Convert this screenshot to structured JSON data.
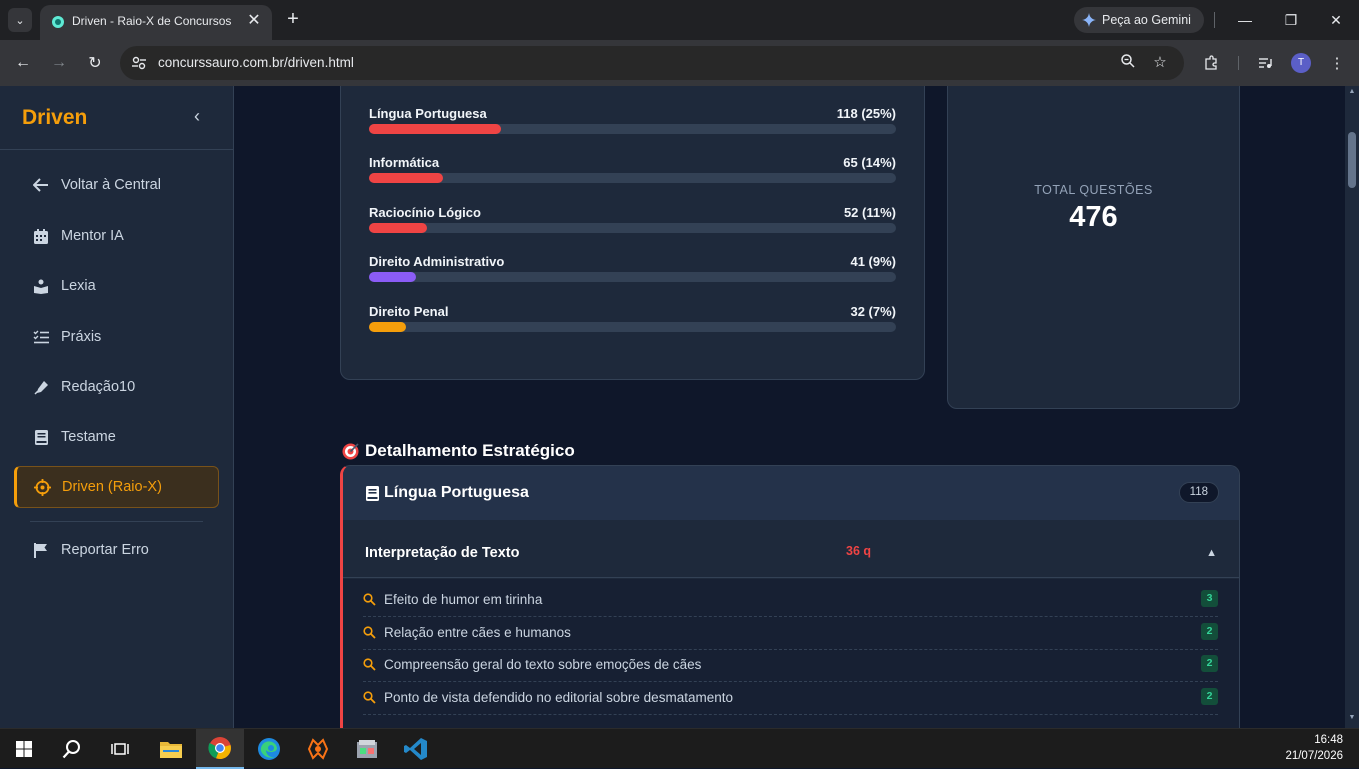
{
  "browser": {
    "tab_title": "Driven - Raio-X de Concursos",
    "url": "concurssauro.com.br/driven.html",
    "gemini_label": "Peça ao Gemini",
    "profile_initial": "T"
  },
  "sidebar": {
    "brand": "Driven",
    "items": [
      {
        "label": "Voltar à Central",
        "icon": "arrow-left-icon"
      },
      {
        "label": "Mentor IA",
        "icon": "calendar-icon"
      },
      {
        "label": "Lexia",
        "icon": "reader-icon"
      },
      {
        "label": "Práxis",
        "icon": "checklist-icon"
      },
      {
        "label": "Redação10",
        "icon": "pen-icon"
      },
      {
        "label": "Testame",
        "icon": "book-icon"
      },
      {
        "label": "Driven (Raio-X)",
        "icon": "crosshair-icon",
        "active": true
      },
      {
        "label": "Reportar Erro",
        "icon": "flag-icon"
      }
    ]
  },
  "distribution": [
    {
      "name": "Língua Portuguesa",
      "value": "118 (25%)",
      "percent": 25,
      "color": "#ef4444"
    },
    {
      "name": "Informática",
      "value": "65 (14%)",
      "percent": 14,
      "color": "#ef4444"
    },
    {
      "name": "Raciocínio Lógico",
      "value": "52 (11%)",
      "percent": 11,
      "color": "#ef4444"
    },
    {
      "name": "Direito Administrativo",
      "value": "41 (9%)",
      "percent": 9,
      "color": "#8b5cf6"
    },
    {
      "name": "Direito Penal",
      "value": "32 (7%)",
      "percent": 7,
      "color": "#f59e0b"
    }
  ],
  "total": {
    "label": "TOTAL QUESTÕES",
    "value": "476"
  },
  "detail": {
    "section_title": "Detalhamento Estratégico",
    "subject": "Língua Portuguesa",
    "subject_count": "118",
    "topic": "Interpretação de Texto",
    "topic_count": "36 q",
    "topic_toggle": "▲",
    "items": [
      {
        "text": "Efeito de humor em tirinha",
        "count": "3"
      },
      {
        "text": "Relação entre cães e humanos",
        "count": "2"
      },
      {
        "text": "Compreensão geral do texto sobre emoções de cães",
        "count": "2"
      },
      {
        "text": "Ponto de vista defendido no editorial sobre desmatamento",
        "count": "2"
      }
    ]
  },
  "taskbar": {
    "time": "16:48",
    "date": "21/07/2026"
  },
  "colors": {
    "accent": "#f59e0b",
    "danger": "#ef4444",
    "background": "#0f172a",
    "panel": "#1e293b"
  }
}
